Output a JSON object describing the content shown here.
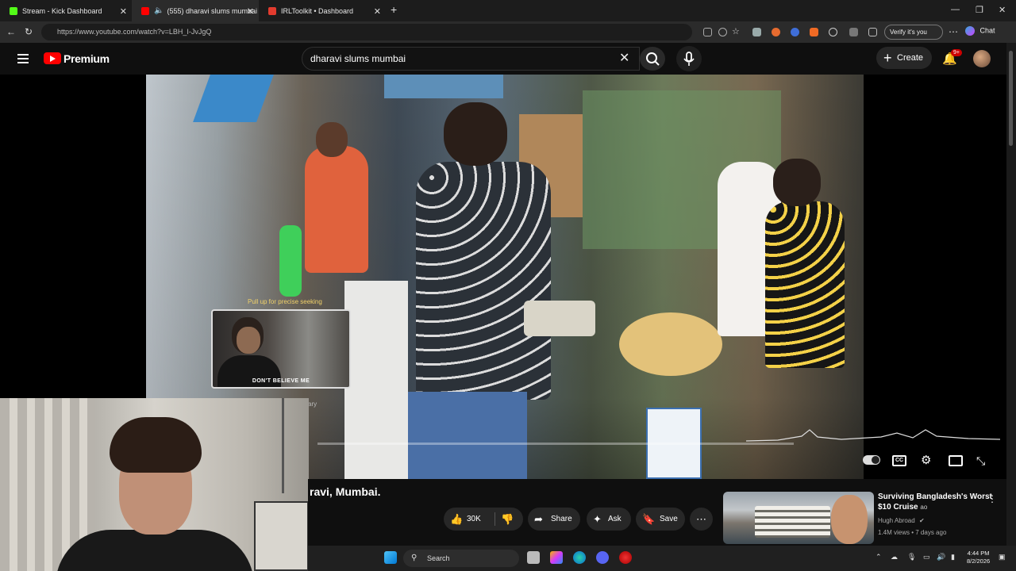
{
  "browser": {
    "tabs": [
      {
        "title": "Stream - Kick Dashboard",
        "fav_color": "#53fc18",
        "active": false
      },
      {
        "title": "(555) dharavi slums mumbai",
        "fav_color": "#ff0000",
        "active": true
      },
      {
        "title": "IRLToolkit • Dashboard",
        "fav_color": "#e33b2e",
        "active": false
      }
    ],
    "url": "https://www.youtube.com/watch?v=LBH_I-JvJgQ",
    "verify_label": "Verify it's you",
    "chat_label": "Chat"
  },
  "youtube": {
    "brand": "Premium",
    "search_value": "dharavi slums mumbai",
    "create_label": "Create",
    "notification_count": "9+",
    "video": {
      "seek_tip": "Pull up for precise seeking",
      "preview_caption": "DON'T BELIEVE ME",
      "chapter_tag": "ary",
      "progress": 0.0,
      "title": "ravi, Mumbai."
    },
    "actions": {
      "likes": "30K",
      "share": "Share",
      "ask": "Ask",
      "save": "Save"
    },
    "recommendation": {
      "title": "Surviving Bangladesh's Worst $10 Cruise",
      "title_suffix": "ao",
      "channel": "Hugh Abroad",
      "meta": "1.4M views • 7 days ago"
    }
  },
  "taskbar": {
    "search_label": "Search",
    "time": "4:44 PM",
    "date": "8/2/2026"
  }
}
